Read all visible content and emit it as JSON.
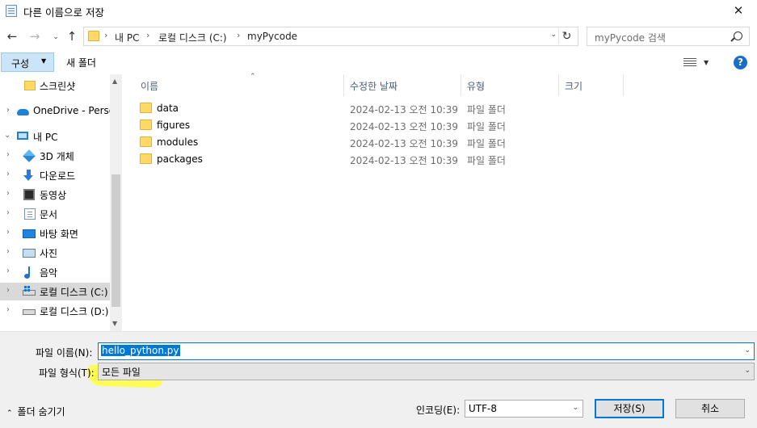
{
  "window": {
    "title": "다른 이름으로 저장",
    "close_symbol": "✕"
  },
  "nav": {
    "back_symbol": "←",
    "forward_symbol": "→",
    "recent_symbol": "⌄",
    "up_symbol": "↑",
    "breadcrumb": [
      "내 PC",
      "로컬 디스크 (C:)",
      "myPycode"
    ],
    "separator": "›",
    "dropdown_symbol": "⌄",
    "refresh_symbol": "↻",
    "search_placeholder": "myPycode 검색"
  },
  "toolbar": {
    "organize_label": "구성",
    "organize_caret": "▼",
    "new_folder_label": "새 폴더",
    "view_caret": "▼",
    "help_label": "?"
  },
  "sidebar": {
    "items": [
      {
        "label": "스크린샷",
        "icon": "folder-icon"
      },
      {
        "label": "OneDrive - Person",
        "icon": "onedrive-icon"
      },
      {
        "label": "내 PC",
        "icon": "pc-icon"
      },
      {
        "label": "3D 개체",
        "icon": "objects-3d-icon"
      },
      {
        "label": "다운로드",
        "icon": "download-icon"
      },
      {
        "label": "동영상",
        "icon": "video-icon"
      },
      {
        "label": "문서",
        "icon": "document-icon"
      },
      {
        "label": "바탕 화면",
        "icon": "desktop-icon"
      },
      {
        "label": "사진",
        "icon": "picture-icon"
      },
      {
        "label": "음악",
        "icon": "music-icon"
      },
      {
        "label": "로컬 디스크 (C:)",
        "icon": "drive-c-icon",
        "selected": true
      },
      {
        "label": "로컬 디스크 (D:)",
        "icon": "drive-d-icon"
      }
    ],
    "chevron_collapsed": "›",
    "chevron_expanded": "⌄",
    "scroll_up": "▲",
    "scroll_down": "▼"
  },
  "file_list": {
    "columns": [
      "이름",
      "수정한 날짜",
      "유형",
      "크기"
    ],
    "sort_arrow": "⌃",
    "rows": [
      {
        "name": "data",
        "modified": "2024-02-13 오전 10:39",
        "type": "파일 폴더"
      },
      {
        "name": "figures",
        "modified": "2024-02-13 오전 10:39",
        "type": "파일 폴더"
      },
      {
        "name": "modules",
        "modified": "2024-02-13 오전 10:39",
        "type": "파일 폴더"
      },
      {
        "name": "packages",
        "modified": "2024-02-13 오전 10:39",
        "type": "파일 폴더"
      }
    ]
  },
  "form": {
    "filename_label": "파일 이름(N):",
    "filename_value": "hello_python.py",
    "filetype_label": "파일 형식(T):",
    "filetype_value": "모든 파일",
    "caret": "⌄"
  },
  "footer": {
    "hide_folders_arrow": "⌃",
    "hide_folders_label": "폴더 숨기기",
    "encoding_label": "인코딩(E):",
    "encoding_value": "UTF-8",
    "save_label": "저장(S)",
    "cancel_label": "취소"
  },
  "colors": {
    "accent": "#0078d7",
    "organize_bg": "#cce4f7",
    "highlight": "#ffff3a",
    "folder": "#ffd966"
  }
}
